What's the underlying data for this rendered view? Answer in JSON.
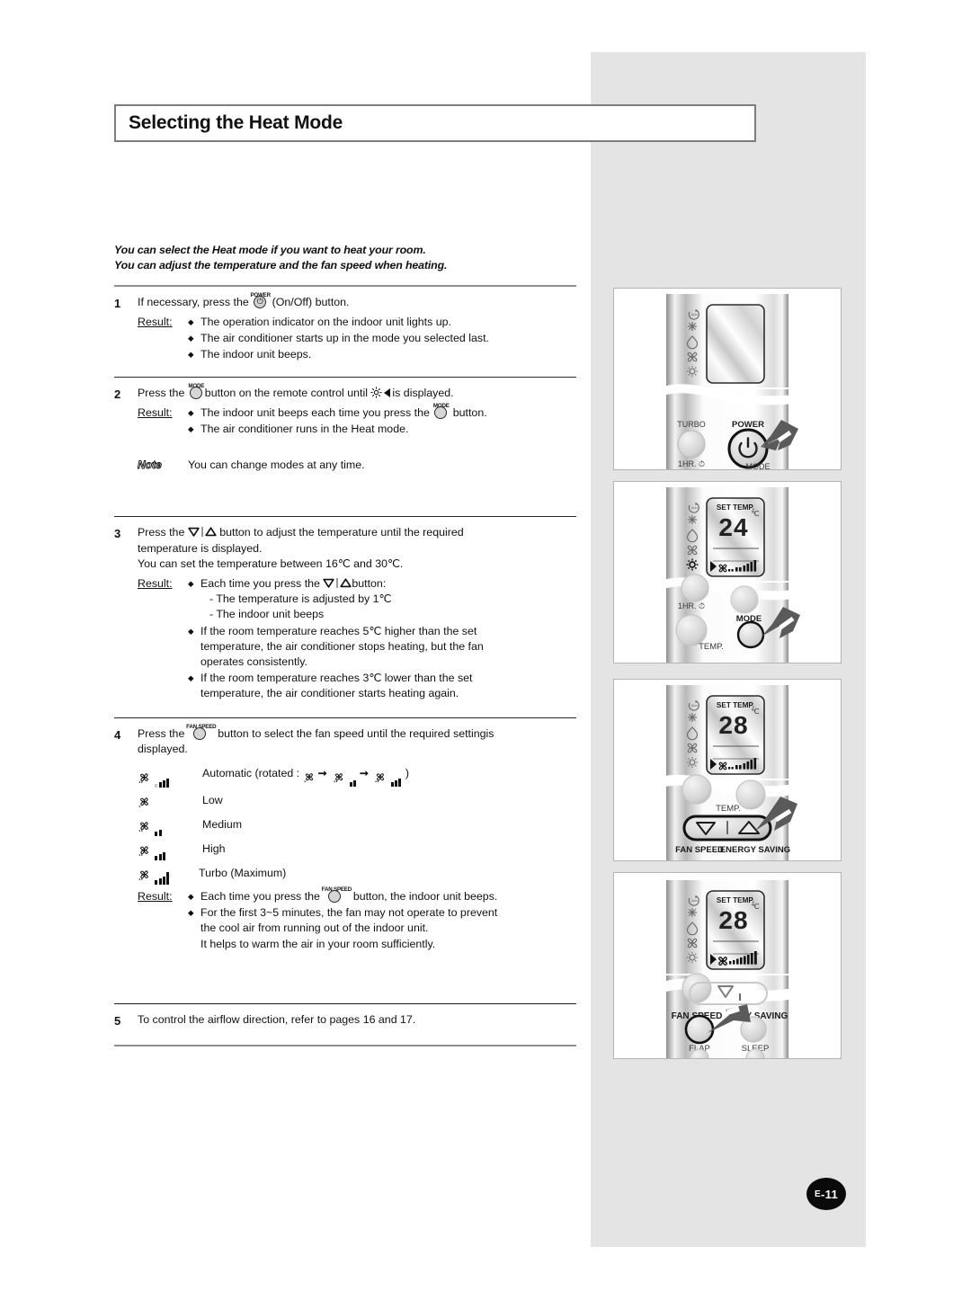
{
  "page": {
    "title": "Selecting the Heat Mode",
    "number": "E-11",
    "number_prefix": "E",
    "number_suffix": "-11"
  },
  "intro": {
    "line1": "You can select the Heat mode if you want to heat your room.",
    "line2": "You can adjust the temperature and the fan speed when heating."
  },
  "labels": {
    "result": "Result:",
    "note": "Note",
    "power_cap": "POWER",
    "mode_cap": "MODE",
    "fanspeed_cap": "FAN SPEED"
  },
  "steps": {
    "s1": {
      "num": "1",
      "text_before": "If necessary, press the",
      "text_after": "(On/Off) button.",
      "results": [
        "The operation indicator on the indoor unit lights up.",
        "The air conditioner starts up in the mode you selected last.",
        "The indoor unit beeps."
      ]
    },
    "s2": {
      "num": "2",
      "text_before": "Press the",
      "text_mid": "button on the remote control until",
      "text_after": "is displayed.",
      "result_before": "The indoor unit beeps each time you press the",
      "result_after": "button.",
      "result2": "The air conditioner runs in the Heat mode.",
      "note": "You can change modes at any time."
    },
    "s3": {
      "num": "3",
      "text_before": "Press the",
      "text_after": "button to adjust the temperature until the required",
      "line2": "temperature is displayed.",
      "line3": "You can set the temperature between 16℃ and 30℃.",
      "result_before": "Each time you press the",
      "result_after": "button:",
      "sub1": "- The temperature is adjusted by 1℃",
      "sub2": "- The indoor unit beeps",
      "result2_l1": "If the room temperature reaches 5℃ higher than the set",
      "result2_l2": "temperature, the air conditioner stops heating, but the fan",
      "result2_l3": "operates consistently.",
      "result3_l1": "If the room temperature reaches 3℃ lower than the set",
      "result3_l2": "temperature, the air conditioner starts heating again."
    },
    "s4": {
      "num": "4",
      "text_before": "Press the",
      "text_after": "button to select the fan speed until the required settingis",
      "line2": "displayed.",
      "fan_speeds": [
        {
          "label": "Automatic (rotated :",
          "label_close": ")",
          "bars": 4,
          "auto": true
        },
        {
          "label": "Low",
          "bars": 1,
          "auto": false
        },
        {
          "label": "Medium",
          "bars": 2,
          "auto": false
        },
        {
          "label": "High",
          "bars": 3,
          "auto": false
        },
        {
          "label": "Turbo (Maximum)",
          "bars": 5,
          "auto": false
        }
      ],
      "result_before": "Each time you press the",
      "result_after": "button, the indoor unit beeps.",
      "result2_l1": "For the first 3~5 minutes, the fan may not operate to prevent",
      "result2_l2": "the cool air from running out of the indoor unit.",
      "result2_l3": "It helps to warm the air in your room sufficiently."
    },
    "s5": {
      "num": "5",
      "text": "To control the airflow direction, refer to pages 16 and 17."
    }
  },
  "illustrations": {
    "panel1": {
      "button_labels": [
        "TURBO",
        "POWER",
        "1HR.",
        "MODE"
      ],
      "mode_icons": [
        "auto-icon",
        "snowflake-icon",
        "droplet-icon",
        "fan-icon",
        "sun-icon"
      ],
      "highlight": "POWER"
    },
    "panel2": {
      "lcd": {
        "set_temp_label": "SET TEMP.",
        "value": "24",
        "unit": "℃"
      },
      "button_labels": [
        "1HR.",
        "MODE",
        "TEMP."
      ],
      "highlight": "MODE"
    },
    "panel3": {
      "lcd": {
        "set_temp_label": "SET TEMP.",
        "value": "28",
        "unit": "℃"
      },
      "button_labels": [
        "TEMP.",
        "FAN SPEED",
        "ENERGY SAVING"
      ],
      "highlight": "TEMP-UP"
    },
    "panel4": {
      "lcd": {
        "set_temp_label": "SET TEMP.",
        "value": "28",
        "unit": "℃"
      },
      "button_labels": [
        "FAN SPEED",
        "GY SAVING",
        "FLAP",
        "SLEEP"
      ],
      "highlight": "FAN SPEED"
    }
  }
}
